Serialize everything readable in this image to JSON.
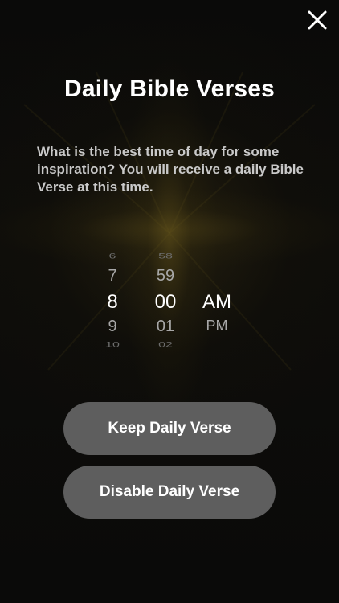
{
  "header": {
    "close_icon": "close-icon",
    "title": "Daily Bible Verses"
  },
  "prompt": {
    "text": "What is the best time of day for some inspiration?  You will receive a daily Bible Verse at this time."
  },
  "time_picker": {
    "hour": {
      "items": [
        "6",
        "7",
        "8",
        "9",
        "10"
      ],
      "selected": "8"
    },
    "minute": {
      "items": [
        "58",
        "59",
        "00",
        "01",
        "02"
      ],
      "selected": "00"
    },
    "period": {
      "items": [
        "AM",
        "PM"
      ],
      "selected": "AM"
    }
  },
  "buttons": {
    "keep_label": "Keep Daily Verse",
    "disable_label": "Disable Daily Verse"
  }
}
